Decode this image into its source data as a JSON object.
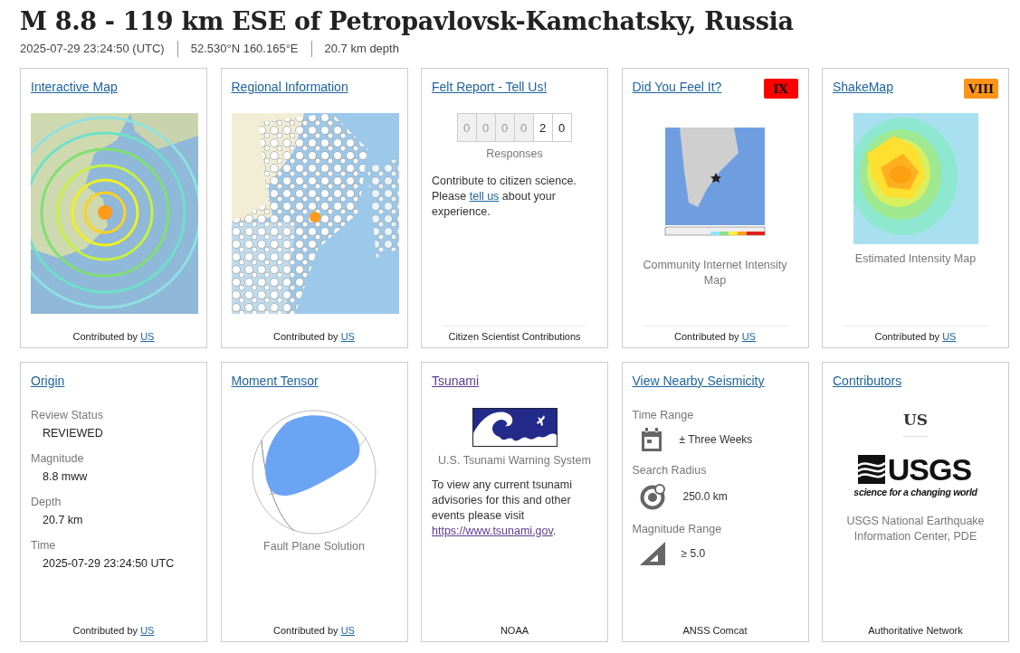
{
  "header": {
    "title": "M 8.8 - 119 km ESE of Petropavlovsk-Kamchatsky, Russia",
    "meta": [
      "2025-07-29 23:24:50 (UTC)",
      "52.530°N 160.165°E",
      "20.7 km depth"
    ]
  },
  "cards": [
    {
      "kind": "interactive_map",
      "title": "Interactive Map",
      "link_visited": false,
      "footer": {
        "text": "Contributed by",
        "link": "US"
      }
    },
    {
      "kind": "regional_map",
      "title": "Regional Information",
      "link_visited": false,
      "footer": {
        "text": "Contributed by",
        "link": "US"
      }
    },
    {
      "kind": "felt",
      "title": "Felt Report - Tell Us!",
      "link_visited": false,
      "counter": [
        {
          "digit": "0",
          "filled": false
        },
        {
          "digit": "0",
          "filled": false
        },
        {
          "digit": "0",
          "filled": false
        },
        {
          "digit": "0",
          "filled": false
        },
        {
          "digit": "2",
          "filled": true
        },
        {
          "digit": "0",
          "filled": true
        }
      ],
      "counter_label": "Responses",
      "text_before": "Contribute to citizen science. Please",
      "link": "tell us",
      "text_after": "about your experience.",
      "footer": {
        "text": "Citizen Scientist Contributions"
      }
    },
    {
      "kind": "dyfi_map",
      "title": "Did You Feel It?",
      "link_visited": false,
      "badge": {
        "text": "IX",
        "color": "#ff0000"
      },
      "caption": "Community Internet Intensity Map",
      "footer": {
        "text": "Contributed by",
        "link": "US"
      }
    },
    {
      "kind": "shakemap",
      "title": "ShakeMap",
      "link_visited": false,
      "badge": {
        "text": "VIII",
        "color": "#ff9419"
      },
      "caption": "Estimated Intensity Map",
      "footer": {
        "text": "Contributed by",
        "link": "US"
      }
    },
    {
      "kind": "origin",
      "title": "Origin",
      "link_visited": false,
      "fields": [
        {
          "label": "Review Status",
          "value": "REVIEWED"
        },
        {
          "label": "Magnitude",
          "value": "8.8 mww"
        },
        {
          "label": "Depth",
          "value": "20.7 km"
        },
        {
          "label": "Time",
          "value": "2025-07-29 23:24:50 UTC"
        }
      ],
      "footer": {
        "text": "Contributed by",
        "link": "US"
      }
    },
    {
      "kind": "moment_tensor",
      "title": "Moment Tensor",
      "link_visited": false,
      "caption": "Fault Plane Solution",
      "footer": {
        "text": "Contributed by",
        "link": "US"
      }
    },
    {
      "kind": "tsunami",
      "title": "Tsunami",
      "link_visited": true,
      "caption": "U.S. Tsunami Warning System",
      "text_before": "To view any current tsunami advisories for this and other events please visit",
      "link": "https://www.tsunami.gov",
      "text_after": ".",
      "footer": {
        "text": "NOAA"
      }
    },
    {
      "kind": "seismicity",
      "title": "View Nearby Seismicity",
      "link_visited": false,
      "items": [
        {
          "label": "Time Range",
          "kind": "calendar",
          "value": "± Three Weeks"
        },
        {
          "label": "Search Radius",
          "kind": "radius",
          "value": "250.0 km"
        },
        {
          "label": "Magnitude Range",
          "kind": "magnitude",
          "value": "≥ 5.0"
        }
      ],
      "footer": {
        "text": "ANSS Comcat"
      }
    },
    {
      "kind": "contributors",
      "title": "Contributors",
      "link_visited": false,
      "network": "US",
      "logo": {
        "wordmark": "USGS",
        "tagline": "science for a changing world"
      },
      "caption": "USGS National Earthquake Information Center, PDE",
      "footer": {
        "text": "Authoritative Network"
      }
    }
  ]
}
